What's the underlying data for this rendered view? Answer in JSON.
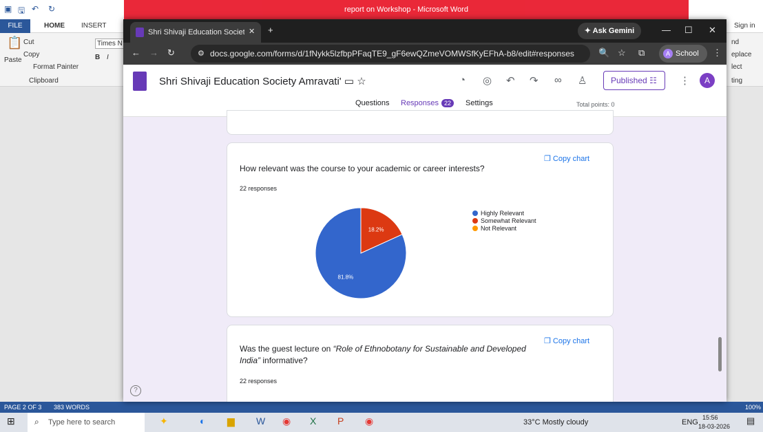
{
  "word": {
    "title": "report on Workshop - Microsoft Word",
    "tabs": [
      "FILE",
      "HOME",
      "INSERT"
    ],
    "right_tabs": {
      "signin": "Sign in"
    },
    "ribbon": {
      "cut": "Cut",
      "copy": "Copy",
      "paste": "Paste",
      "format_painter": "Format Painter",
      "clipboard": "Clipboard",
      "font": "Times N",
      "find": "nd",
      "replace": "eplace",
      "select": "lect",
      "editing": "ting"
    },
    "status": {
      "page": "PAGE 2 OF 3",
      "words": "383 WORDS",
      "zoom": "100%"
    }
  },
  "chrome": {
    "tab_title": "Shri Shivaji Education Society A",
    "url": "docs.google.com/forms/d/1fNykk5lzfbpPFaqTE9_gF6ewQZmeVOMWSfKyEFhA-b8/edit#responses",
    "gemini": "Ask Gemini",
    "profile": "School"
  },
  "form": {
    "title": "Shri Shivaji Education Society Amravati'",
    "published": "Published",
    "avatar": "A",
    "tabs": {
      "questions": "Questions",
      "responses": "Responses",
      "settings": "Settings"
    },
    "response_count": "22",
    "total_points": "Total points: 0"
  },
  "question1": {
    "text": "How relevant was the course to your academic or career interests?",
    "responses": "22 responses",
    "copy": "Copy chart"
  },
  "question2": {
    "text_a": "Was the guest lecture on ",
    "text_b": "“Role of Ethnobotany for Sustainable and Developed",
    "text_c": "India”",
    "text_d": " informative?",
    "responses": "22 responses",
    "copy": "Copy chart"
  },
  "taskbar": {
    "search": "Type here to search",
    "weather": "33°C  Mostly cloudy",
    "lang": "ENG",
    "time": "15:56",
    "date": "18-03-2026"
  },
  "chart_data": {
    "type": "pie",
    "labels": [
      "Highly Relevant",
      "Somewhat Relevant",
      "Not Relevant"
    ],
    "values": [
      81.8,
      18.2,
      0
    ],
    "value_labels": [
      "81.8%",
      "18.2%"
    ],
    "colors": [
      "#3366cc",
      "#dc3912",
      "#ff9900"
    ],
    "legend": "right"
  }
}
